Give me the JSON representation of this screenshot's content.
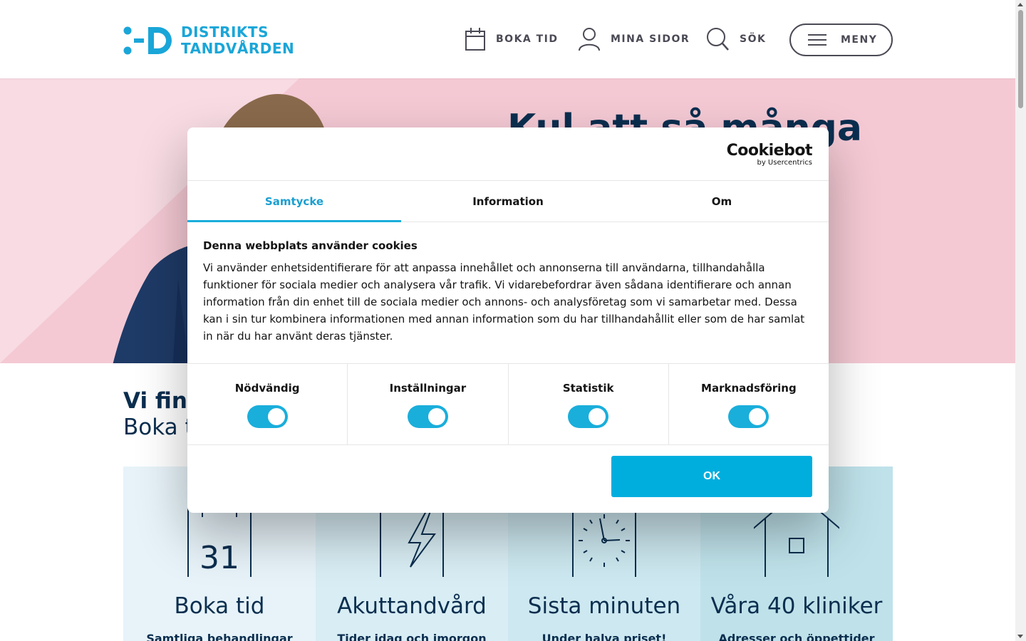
{
  "header": {
    "logo_line1": "DISTRIKTS",
    "logo_line2": "TANDVÅRDEN",
    "nav": {
      "book": "BOKA TID",
      "my_pages": "MINA SIDOR",
      "search": "SÖK",
      "menu": "MENY"
    }
  },
  "hero": {
    "title": "Kul att så många"
  },
  "intro": {
    "title": "Vi finn",
    "subtitle": "Boka t"
  },
  "cards": [
    {
      "title": "Boka tid",
      "subtitle": "Samtliga behandlingar",
      "icon_number": "31"
    },
    {
      "title": "Akuttandvård",
      "subtitle": "Tider idag och imorgon"
    },
    {
      "title": "Sista minuten",
      "subtitle": "Under halva priset!"
    },
    {
      "title": "Våra 40 kliniker",
      "subtitle": "Adresser och öppettider"
    }
  ],
  "cookie_dialog": {
    "brand": "Cookiebot",
    "brand_by": "by Usercentrics",
    "tabs": [
      "Samtycke",
      "Information",
      "Om"
    ],
    "active_tab": "Samtycke",
    "heading": "Denna webbplats använder cookies",
    "body": "Vi använder enhetsidentifierare för att anpassa innehållet och annonserna till användarna, tillhandahålla funktioner för sociala medier och analysera vår trafik. Vi vidarebefordrar även sådana identifierare och annan information från din enhet till de sociala medier och annons- och analysföretag som vi samarbetar med. Dessa kan i sin tur kombinera informationen med annan information som du har tillhandahållit eller som de har samlat in när du har använt deras tjänster.",
    "toggles": [
      {
        "label": "Nödvändig",
        "on": true
      },
      {
        "label": "Inställningar",
        "on": true
      },
      {
        "label": "Statistik",
        "on": true
      },
      {
        "label": "Marknadsföring",
        "on": true
      }
    ],
    "ok_label": "OK"
  },
  "colors": {
    "brand_blue": "#1aa6d8",
    "navy": "#0b2e4f",
    "hero_pink": "#f4c9d4",
    "accent_cyan": "#00aede"
  }
}
